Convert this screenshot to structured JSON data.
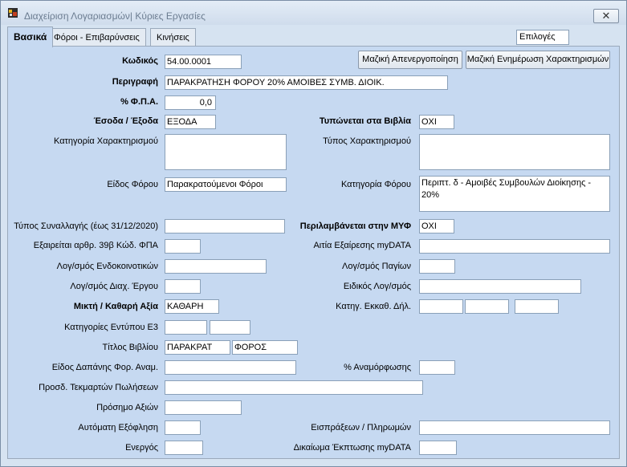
{
  "window": {
    "title": "Διαχείριση Λογαριασμών| Κύριες Εργασίες",
    "close_label": "✕"
  },
  "tabs": [
    "Βασικά",
    "Φόροι - Επιβαρύνσεις",
    "Κινήσεις"
  ],
  "options_label": "Επιλογές",
  "buttons": {
    "mass_deactivate": "Μαζική Απενεργοποίηση",
    "mass_update": "Μαζική Ενημέρωση Χαρακτηρισμών"
  },
  "labels": {
    "code": "Κωδικός",
    "description": "Περιγραφή",
    "vat": "% Φ.Π.Α.",
    "income_expense": "Έσοδα / Έξοδα",
    "printed_in_books": "Τυπώνεται στα Βιβλία",
    "category_char": "Κατηγορία Χαρακτηρισμού",
    "type_char": "Τύπος Χαρακτηρισμού",
    "tax_kind": "Είδος Φόρου",
    "tax_category": "Κατηγορία Φόρου",
    "transaction_type": "Τύπος Συναλλαγής (έως 31/12/2020)",
    "included_myf": "Περιλαμβάνεται στην ΜΥΦ",
    "exempt_39b": "Εξαιρείται αρθρ. 39β Κώδ. ΦΠΑ",
    "exemption_reason": "Αιτία Εξαίρεσης myDATA",
    "intra_community": "Λογ/σμός Ενδοκοινοτικών",
    "fixed_assets": "Λογ/σμός  Παγίων",
    "project_mgmt": "Λογ/σμός Διαχ. Έργου",
    "special_account": "Ειδικός Λογ/σμός",
    "gross_net": "Μικτή  / Καθαρή Αξία",
    "clearance_category": "Κατηγ. Εκκαθ. Δήλ.",
    "e3_categories": "Κατηγορίες Εντύπου Ε3",
    "book_title": "Τίτλος Βιβλίου",
    "expense_kind": "Είδος Δαπάνης Φορ. Αναμ.",
    "revaluation": "% Αναμόρφωσης",
    "sales_presumption": "Προσδ. Τεκμαρτών Πωλήσεων",
    "value_sign": "Πρόσημο Αξιών",
    "auto_settlement": "Αυτόματη Εξόφληση",
    "receipts_payments": "Εισπράξεων / Πληρωμών",
    "active": "Ενεργός",
    "deduction_right": "Δικαίωμα Έκπτωσης myDATA"
  },
  "values": {
    "code": "54.00.0001",
    "description": "ΠΑΡΑΚΡΑΤΗΣΗ ΦΟΡΟΥ 20% ΑΜΟΙΒΕΣ ΣΥΜΒ. ΔΙΟΙΚ.",
    "vat": "0,0",
    "income_expense": "ΕΞΟΔΑ",
    "printed_in_books": "ΟΧΙ",
    "category_char": "",
    "type_char": "",
    "tax_kind": "Παρακρατούμενοι Φόροι",
    "tax_category": "Περιπτ. δ - Αμοιβές Συμβουλών Διοίκησης - 20%",
    "transaction_type": "",
    "included_myf": "ΟΧΙ",
    "exempt_39b": "",
    "exemption_reason": "",
    "intra_community": "",
    "fixed_assets": "",
    "project_mgmt": "",
    "special_account": "",
    "gross_net": "ΚΑΘΑΡΗ",
    "clearance_1": "",
    "clearance_2": "",
    "clearance_3": "",
    "e3_1": "",
    "e3_2": "",
    "book_title_1": "ΠΑΡΑΚΡΑΤ",
    "book_title_2": "ΦΟΡΟΣ",
    "expense_kind": "",
    "revaluation": "",
    "sales_presumption": "",
    "value_sign": "",
    "auto_settlement": "",
    "receipts_payments": "",
    "active": "",
    "deduction_right": ""
  }
}
